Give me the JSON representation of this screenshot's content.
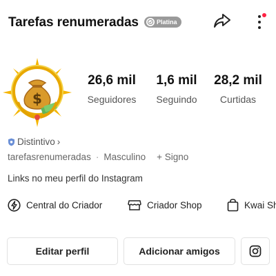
{
  "header": {
    "name": "Tarefas renumeradas",
    "badge_label": "Platina",
    "share_icon": "share-icon",
    "more_icon": "more-vertical-icon",
    "notification_color": "#ff2244"
  },
  "stats": [
    {
      "value": "26,6 mil",
      "label": "Seguidores"
    },
    {
      "value": "1,6 mil",
      "label": "Seguindo"
    },
    {
      "value": "28,2 mil",
      "label": "Curtidas"
    }
  ],
  "profile": {
    "distintivo_label": "Distintivo",
    "distintivo_chevron": "›",
    "username": "tarefasrenumeradas",
    "separator": "·",
    "gender": "Masculino",
    "signo_label": "+ Signo",
    "bio": "Links no meu perfil do Instagram"
  },
  "shortcuts": [
    {
      "label": "Central do Criador",
      "icon": "lightning-icon"
    },
    {
      "label": "Criador Shop",
      "icon": "shop-icon"
    },
    {
      "label": "Kwai Sh",
      "icon": "shopping-bag-icon"
    }
  ],
  "actions": {
    "edit_label": "Editar perfil",
    "add_friends_label": "Adicionar amigos",
    "instagram_icon": "instagram-icon"
  },
  "colors": {
    "badge_bg": "#9a9a9a",
    "avatar_gold": "#e8a800",
    "distintivo_shield": "#6a8fd6"
  }
}
